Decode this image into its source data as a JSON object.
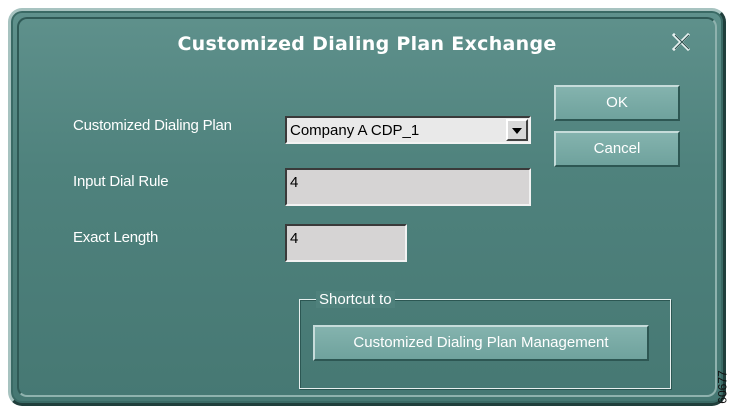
{
  "dialog": {
    "title": "Customized Dialing Plan Exchange",
    "close_icon": "close-x-icon"
  },
  "form": {
    "plan_label": "Customized Dialing Plan",
    "plan_value": "Company A CDP_1",
    "input_rule_label": "Input Dial Rule",
    "input_rule_value": "4",
    "exact_length_label": "Exact Length",
    "exact_length_value": "4"
  },
  "buttons": {
    "ok": "OK",
    "cancel": "Cancel"
  },
  "shortcut": {
    "legend": "Shortcut to",
    "button": "Customized Dialing Plan Management"
  },
  "figure_id": "60677",
  "colors": {
    "dialog_bg": "#4f827d",
    "button_bg": "#7aaba6",
    "field_bg": "#d6d4d4"
  }
}
